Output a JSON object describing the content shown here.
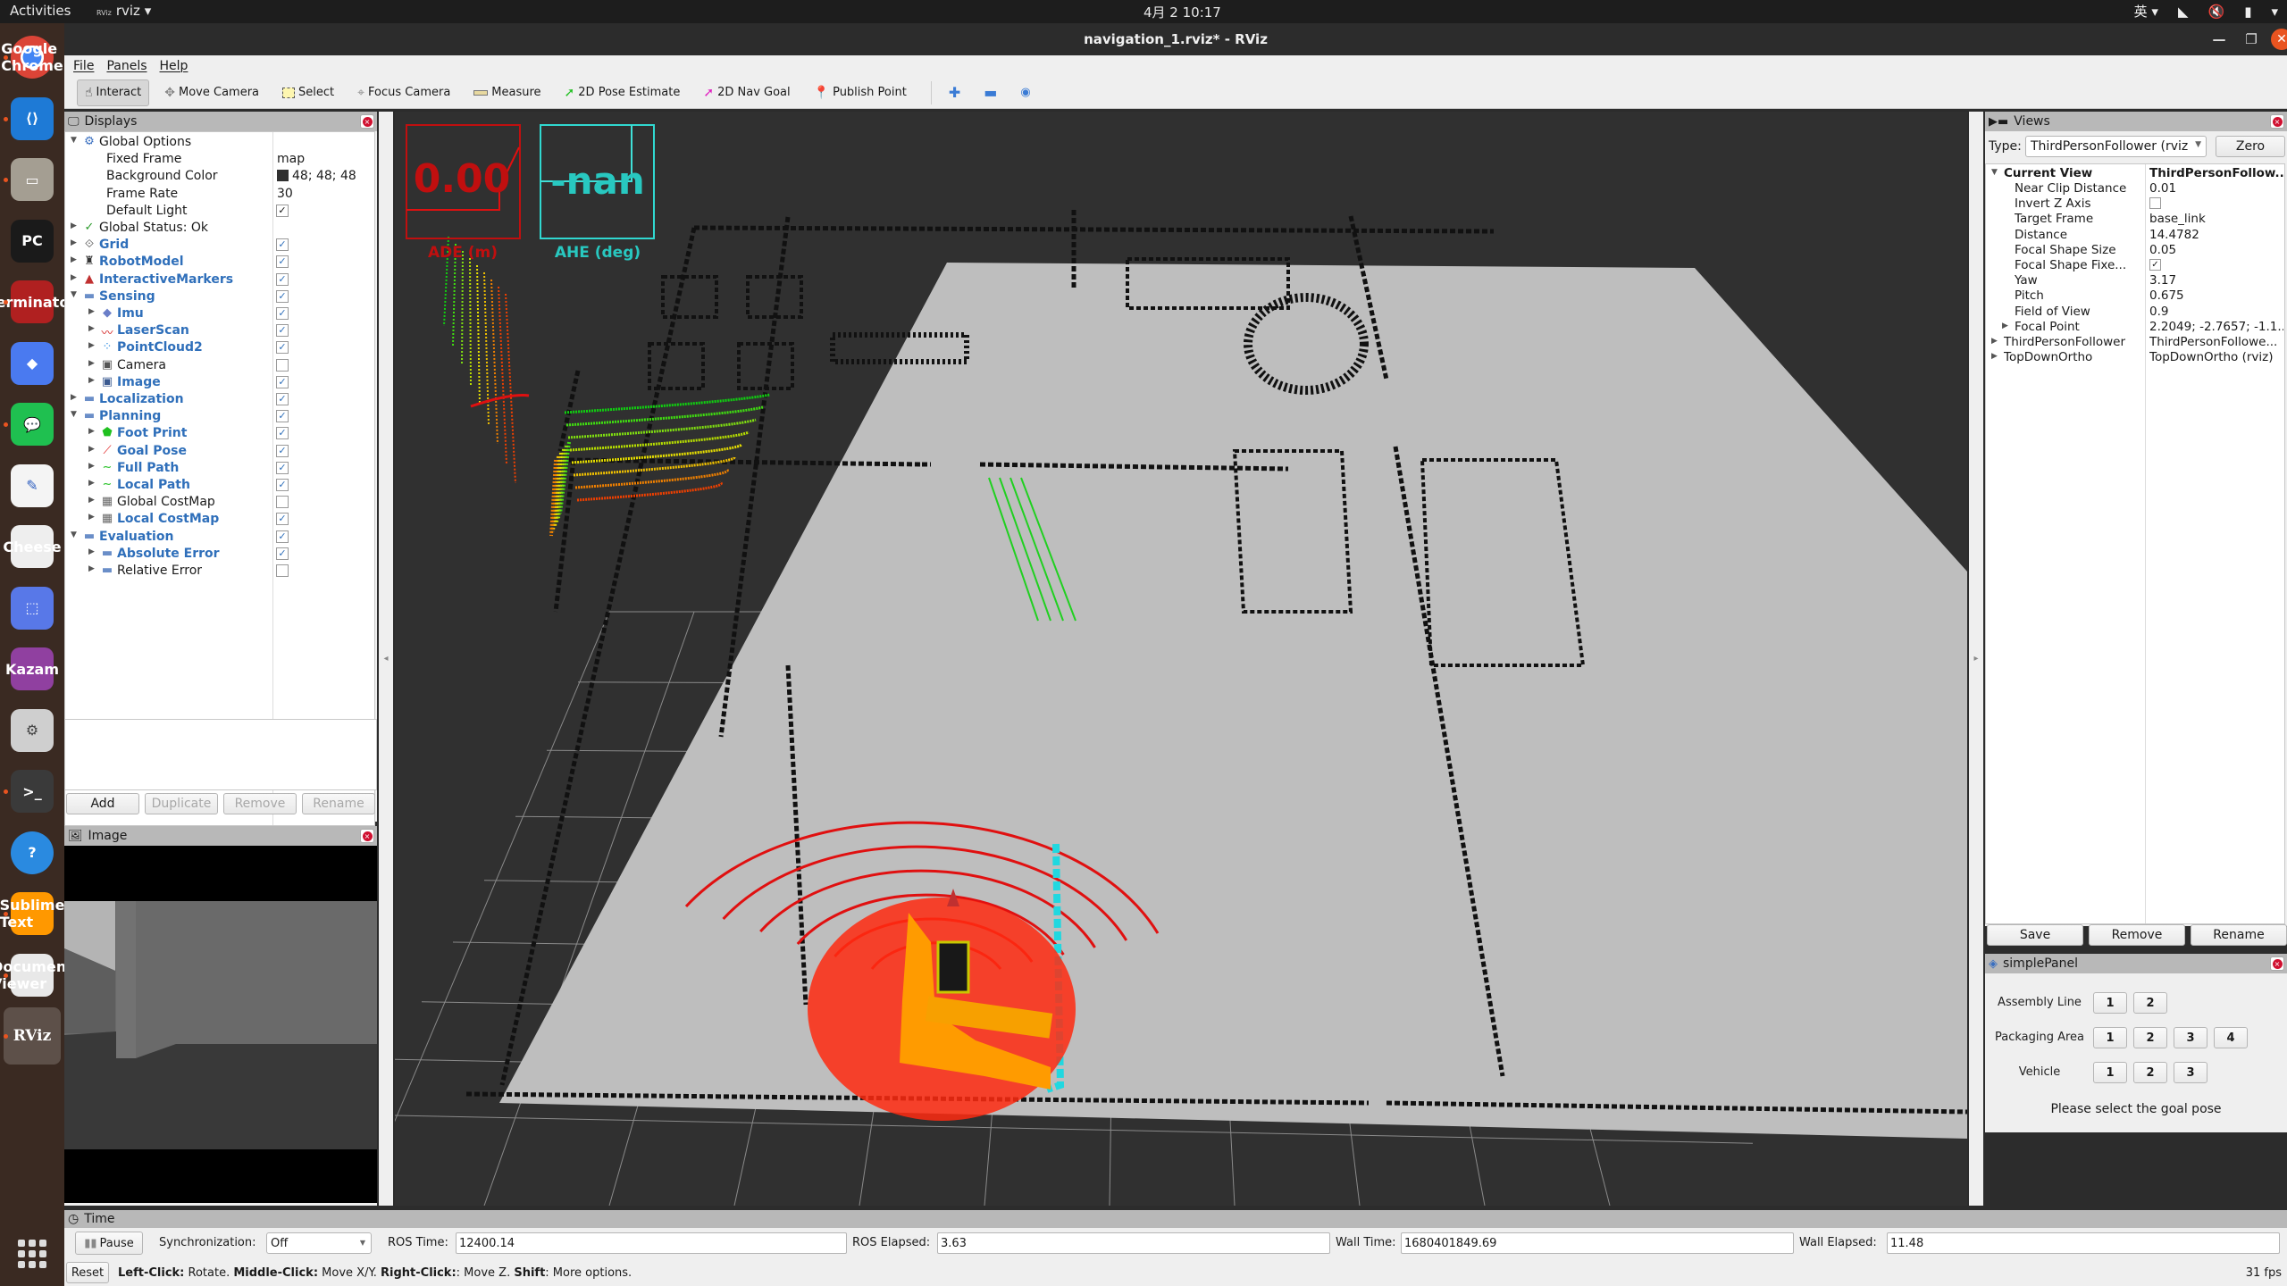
{
  "topbar": {
    "activities": "Activities",
    "app_name": "rviz",
    "clock": "4月 2  10:17",
    "input_method": "英"
  },
  "dock": {
    "apps": [
      {
        "name": "Google Chrome",
        "icon": "chrome-icon",
        "running": true
      },
      {
        "name": "Visual Studio Code",
        "icon": "vscode-icon",
        "running": true
      },
      {
        "name": "Files",
        "icon": "files-icon",
        "running": true
      },
      {
        "name": "PyCharm",
        "icon": "pycharm-icon",
        "running": false
      },
      {
        "name": "Terminator",
        "icon": "terminator-icon",
        "running": true
      },
      {
        "name": "Notes",
        "icon": "eraser-icon",
        "running": false
      },
      {
        "name": "WeChat",
        "icon": "wechat-icon",
        "running": true
      },
      {
        "name": "Text Editor",
        "icon": "text-editor-icon",
        "running": false
      },
      {
        "name": "Cheese",
        "icon": "webcam-icon",
        "running": false
      },
      {
        "name": "Screenshot",
        "icon": "screenshot-icon",
        "running": false
      },
      {
        "name": "Kazam",
        "icon": "video-recorder-icon",
        "running": false
      },
      {
        "name": "Settings",
        "icon": "settings-icon",
        "running": false
      },
      {
        "name": "Terminal",
        "icon": "terminal-icon",
        "running": true
      },
      {
        "name": "Help",
        "icon": "help-icon",
        "running": false
      },
      {
        "name": "Sublime Text",
        "icon": "sublime-icon",
        "running": true
      },
      {
        "name": "Document Viewer",
        "icon": "document-viewer-icon",
        "running": true
      },
      {
        "name": "RViz",
        "icon": "rviz-icon",
        "running": true,
        "label": "RViz"
      }
    ],
    "show_apps": "show-applications-icon"
  },
  "window": {
    "title": "navigation_1.rviz* - RViz"
  },
  "menu": [
    "File",
    "Panels",
    "Help"
  ],
  "toolbar": {
    "tools": [
      {
        "label": "Interact",
        "icon": "hand-pointer-icon",
        "active": true
      },
      {
        "label": "Move Camera",
        "icon": "move-camera-icon",
        "active": false
      },
      {
        "label": "Select",
        "icon": "select-box-icon",
        "active": false
      },
      {
        "label": "Focus Camera",
        "icon": "focus-camera-icon",
        "active": false
      },
      {
        "label": "Measure",
        "icon": "ruler-icon",
        "active": false
      },
      {
        "label": "2D Pose Estimate",
        "icon": "green-arrow-icon",
        "active": false
      },
      {
        "label": "2D Nav Goal",
        "icon": "magenta-arrow-icon",
        "active": false
      },
      {
        "label": "Publish Point",
        "icon": "map-pin-icon",
        "active": false
      }
    ]
  },
  "displays": {
    "title": "Displays",
    "rows": [
      {
        "label": "Global Options",
        "depth": 0,
        "expanded": true,
        "icon": "gear-icon",
        "style": "normal"
      },
      {
        "label": "Fixed Frame",
        "depth": 1,
        "value": "map",
        "style": "normal"
      },
      {
        "label": "Background Color",
        "depth": 1,
        "value": "48; 48; 48",
        "swatch": "#303030",
        "style": "normal"
      },
      {
        "label": "Frame Rate",
        "depth": 1,
        "value": "30",
        "style": "normal"
      },
      {
        "label": "Default Light",
        "depth": 1,
        "checkbox": true,
        "checked": true,
        "style": "normal"
      },
      {
        "label": "Global Status: Ok",
        "depth": 0,
        "expanded": false,
        "icon": "check-icon",
        "style": "normal"
      },
      {
        "label": "Grid",
        "depth": 0,
        "expanded": false,
        "icon": "grid-icon",
        "checkbox": true,
        "checked": true,
        "style": "blue"
      },
      {
        "label": "RobotModel",
        "depth": 0,
        "expanded": false,
        "icon": "robot-model-icon",
        "checkbox": true,
        "checked": true,
        "style": "blue"
      },
      {
        "label": "InteractiveMarkers",
        "depth": 0,
        "expanded": false,
        "icon": "interactive-markers-icon",
        "checkbox": true,
        "checked": true,
        "style": "blue"
      },
      {
        "label": "Sensing",
        "depth": 0,
        "expanded": true,
        "icon": "folder-icon",
        "checkbox": true,
        "checked": true,
        "style": "blue"
      },
      {
        "label": "Imu",
        "depth": 1,
        "expanded": false,
        "icon": "imu-icon",
        "checkbox": true,
        "checked": true,
        "style": "blue"
      },
      {
        "label": "LaserScan",
        "depth": 1,
        "expanded": false,
        "icon": "laserscan-icon",
        "checkbox": true,
        "checked": true,
        "style": "blue"
      },
      {
        "label": "PointCloud2",
        "depth": 1,
        "expanded": false,
        "icon": "pointcloud-icon",
        "checkbox": true,
        "checked": true,
        "style": "blue"
      },
      {
        "label": "Camera",
        "depth": 1,
        "expanded": false,
        "icon": "camera-icon",
        "checkbox": true,
        "checked": false,
        "style": "normal"
      },
      {
        "label": "Image",
        "depth": 1,
        "expanded": false,
        "icon": "image-icon",
        "checkbox": true,
        "checked": true,
        "style": "blue"
      },
      {
        "label": "Localization",
        "depth": 0,
        "expanded": false,
        "icon": "folder-icon",
        "checkbox": true,
        "checked": true,
        "style": "blue"
      },
      {
        "label": "Planning",
        "depth": 0,
        "expanded": true,
        "icon": "folder-icon",
        "checkbox": true,
        "checked": true,
        "style": "blue"
      },
      {
        "label": "Foot Print",
        "depth": 1,
        "expanded": false,
        "icon": "footprint-icon",
        "checkbox": true,
        "checked": true,
        "style": "blue"
      },
      {
        "label": "Goal Pose",
        "depth": 1,
        "expanded": false,
        "icon": "pose-arrow-icon",
        "checkbox": true,
        "checked": true,
        "style": "blue"
      },
      {
        "label": "Full Path",
        "depth": 1,
        "expanded": false,
        "icon": "path-icon",
        "checkbox": true,
        "checked": true,
        "style": "blue"
      },
      {
        "label": "Local Path",
        "depth": 1,
        "expanded": false,
        "icon": "path-icon",
        "checkbox": true,
        "checked": true,
        "style": "blue"
      },
      {
        "label": "Global CostMap",
        "depth": 1,
        "expanded": false,
        "icon": "costmap-icon",
        "checkbox": true,
        "checked": false,
        "style": "normal"
      },
      {
        "label": "Local CostMap",
        "depth": 1,
        "expanded": false,
        "icon": "costmap-icon",
        "checkbox": true,
        "checked": true,
        "style": "blue"
      },
      {
        "label": "Evaluation",
        "depth": 0,
        "expanded": true,
        "icon": "folder-icon",
        "checkbox": true,
        "checked": true,
        "style": "blue"
      },
      {
        "label": "Absolute Error",
        "depth": 1,
        "expanded": false,
        "icon": "folder-icon",
        "checkbox": true,
        "checked": true,
        "style": "blue"
      },
      {
        "label": "Relative Error",
        "depth": 1,
        "expanded": false,
        "icon": "folder-icon",
        "checkbox": true,
        "checked": false,
        "style": "normal"
      }
    ],
    "buttons": {
      "add": "Add",
      "duplicate": "Duplicate",
      "remove": "Remove",
      "rename": "Rename"
    }
  },
  "image_panel": {
    "title": "Image"
  },
  "overlay": {
    "ade": {
      "value": "0.00",
      "label": "ADE (m)",
      "color": "#c00f0f"
    },
    "ahe": {
      "value": "-nan",
      "label": "AHE (deg)",
      "color": "#28c8c0"
    }
  },
  "views": {
    "title": "Views",
    "type_label": "Type:",
    "type_value": "ThirdPersonFollower (rviz",
    "zero": "Zero",
    "current_view": {
      "label": "Current View",
      "value": "ThirdPersonFollow..."
    },
    "props": [
      {
        "label": "Near Clip Distance",
        "value": "0.01"
      },
      {
        "label": "Invert Z Axis",
        "checkbox": true,
        "checked": false
      },
      {
        "label": "Target Frame",
        "value": "base_link"
      },
      {
        "label": "Distance",
        "value": "14.4782"
      },
      {
        "label": "Focal Shape Size",
        "value": "0.05"
      },
      {
        "label": "Focal Shape Fixe...",
        "checkbox": true,
        "checked": true
      },
      {
        "label": "Yaw",
        "value": "3.17"
      },
      {
        "label": "Pitch",
        "value": "0.675"
      },
      {
        "label": "Field of View",
        "value": "0.9"
      },
      {
        "label": "Focal Point",
        "value": "2.2049; -2.7657; -1.1...",
        "expandable": true
      }
    ],
    "saved": [
      {
        "label": "ThirdPersonFollower",
        "value": "ThirdPersonFollowe..."
      },
      {
        "label": "TopDownOrtho",
        "value": "TopDownOrtho (rviz)"
      }
    ],
    "buttons": {
      "save": "Save",
      "remove": "Remove",
      "rename": "Rename"
    }
  },
  "simple_panel": {
    "title": "simplePanel",
    "groups": [
      {
        "label": "Assembly Line",
        "buttons": [
          "1",
          "2"
        ]
      },
      {
        "label": "Packaging Area",
        "buttons": [
          "1",
          "2",
          "3",
          "4"
        ]
      },
      {
        "label": "Vehicle",
        "buttons": [
          "1",
          "2",
          "3"
        ]
      }
    ],
    "message": "Please select the goal pose"
  },
  "time": {
    "title": "Time",
    "pause": "Pause",
    "sync_label": "Synchronization:",
    "sync_value": "Off",
    "ros_time_label": "ROS Time:",
    "ros_time": "12400.14",
    "ros_elapsed_label": "ROS Elapsed:",
    "ros_elapsed": "3.63",
    "wall_time_label": "Wall Time:",
    "wall_time": "1680401849.69",
    "wall_elapsed_label": "Wall Elapsed:",
    "wall_elapsed": "11.48"
  },
  "status": {
    "reset": "Reset",
    "help_parts": [
      {
        "text": "Left-Click:",
        "bold": true
      },
      {
        "text": " Rotate. ",
        "bold": false
      },
      {
        "text": "Middle-Click:",
        "bold": true
      },
      {
        "text": " Move X/Y. ",
        "bold": false
      },
      {
        "text": "Right-Click:",
        "bold": true
      },
      {
        "text": ": Move Z. ",
        "bold": false
      },
      {
        "text": "Shift",
        "bold": true
      },
      {
        "text": ": More options.",
        "bold": false
      }
    ],
    "fps": "31 fps"
  }
}
